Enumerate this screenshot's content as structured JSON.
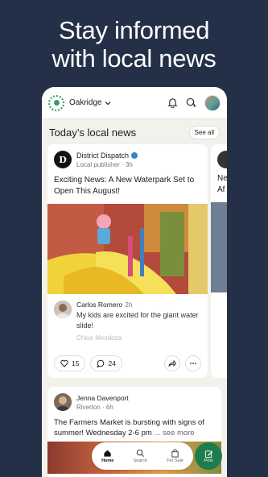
{
  "headline": {
    "line1": "Stay informed",
    "line2": "with local news"
  },
  "topbar": {
    "location": "Oakridge"
  },
  "section": {
    "title": "Today’s local news",
    "see_all": "See all"
  },
  "article": {
    "publisher_initial": "D",
    "publisher": "District Dispatch",
    "publisher_type": "Local publisher",
    "age": "3h",
    "title": "Exciting News: A New Waterpark Set to Open This August!",
    "comment": {
      "author": "Carlos Romero",
      "age": "2h",
      "text": "My kids are excited for the giant water slide!"
    },
    "faded_next": "Chloe Mendoza",
    "likes": "15",
    "comments": "24"
  },
  "side_card": {
    "line1": "Ne",
    "line2": "Af"
  },
  "post": {
    "author": "Jenna Davenport",
    "location": "Riverton",
    "age": "6h",
    "text": "The Farmers Market is bursting with signs of summer! Wednesday 2-6 pm",
    "more": "... see more"
  },
  "nav": {
    "home": "Home",
    "search": "Search",
    "for_sale": "For Sale",
    "post": "Post"
  },
  "colors": {
    "background": "#243047",
    "brand": "#1e7d4c",
    "verified": "#3b82c4"
  }
}
